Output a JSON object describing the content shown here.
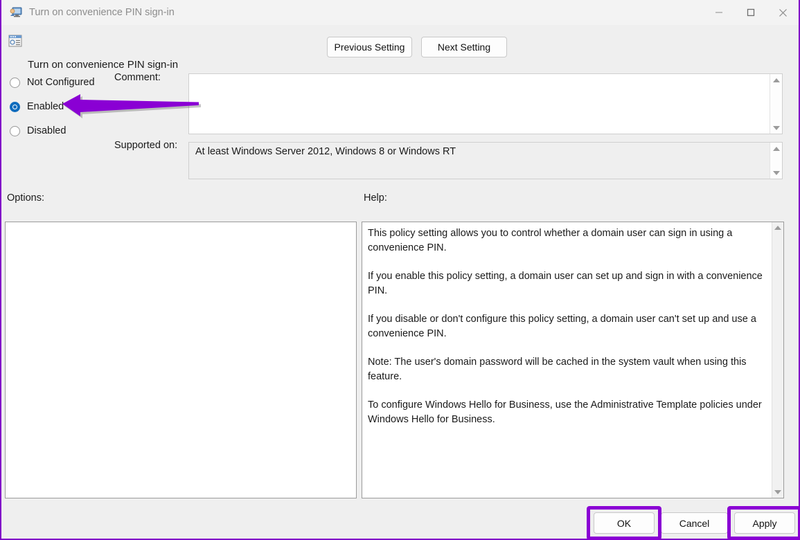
{
  "window": {
    "title": "Turn on convenience PIN sign-in",
    "icon": "policy-monitor-icon",
    "controls": {
      "minimize": "minimize-icon",
      "maximize": "maximize-icon",
      "close": "close-icon"
    }
  },
  "header": {
    "icon": "policy-setting-icon",
    "setting_name": "Turn on convenience PIN sign-in",
    "previous_button": "Previous Setting",
    "next_button": "Next Setting"
  },
  "state": {
    "options": [
      {
        "label": "Not Configured",
        "selected": false
      },
      {
        "label": "Enabled",
        "selected": true
      },
      {
        "label": "Disabled",
        "selected": false
      }
    ],
    "comment_label": "Comment:",
    "comment_value": "",
    "supported_label": "Supported on:",
    "supported_value": "At least Windows Server 2012, Windows 8 or Windows RT"
  },
  "panels": {
    "options_label": "Options:",
    "options_content": "",
    "help_label": "Help:",
    "help_paragraphs": [
      "This policy setting allows you to control whether a domain user can sign in using a convenience PIN.",
      "If you enable this policy setting, a domain user can set up and sign in with a convenience PIN.",
      "If you disable or don't configure this policy setting, a domain user can't set up and use a convenience PIN.",
      "Note: The user's domain password will be cached in the system vault when using this feature.",
      "To configure Windows Hello for Business, use the Administrative Template policies under Windows Hello for Business."
    ]
  },
  "actions": {
    "ok": "OK",
    "cancel": "Cancel",
    "apply": "Apply"
  },
  "annotations": {
    "arrow_target": "Enabled",
    "highlight_color": "#8a00d4",
    "highlighted_buttons": [
      "OK",
      "Apply"
    ]
  }
}
